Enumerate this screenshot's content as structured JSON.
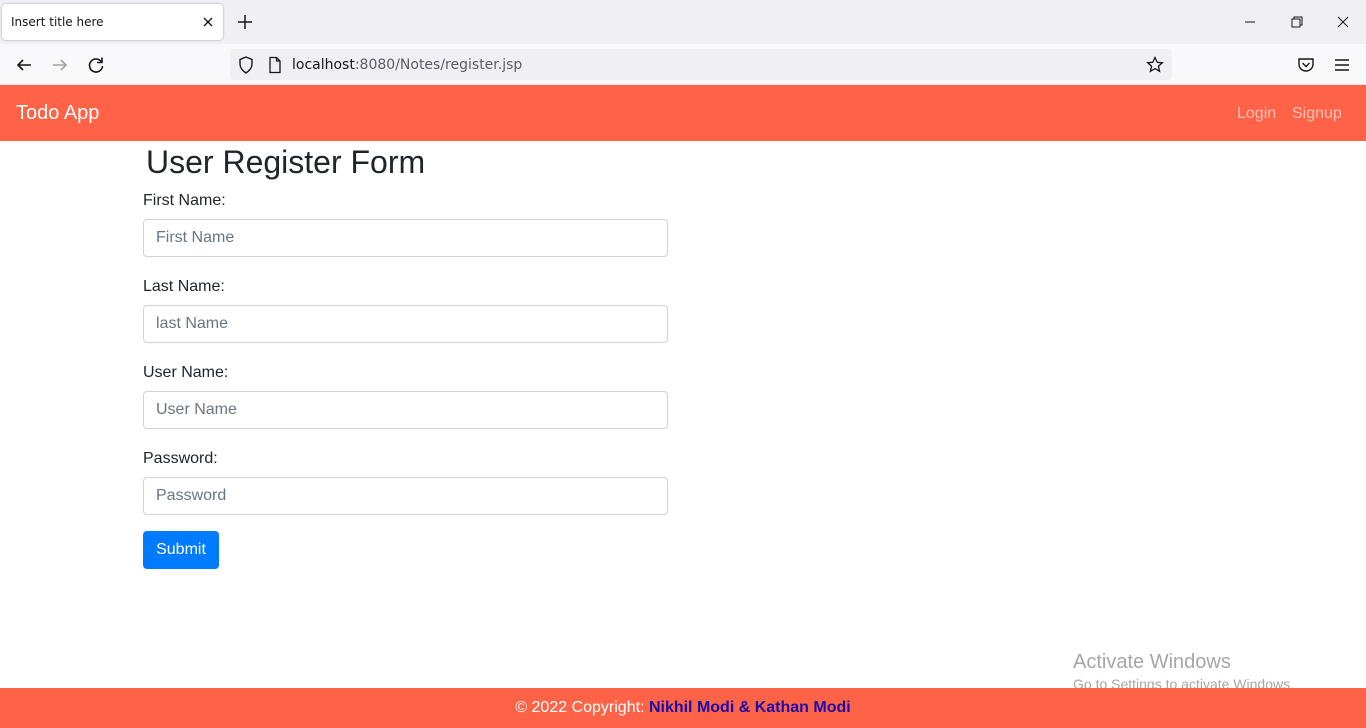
{
  "browser": {
    "tab_title": "Insert title here",
    "url_host": "localhost",
    "url_rest": ":8080/Notes/register.jsp"
  },
  "navbar": {
    "brand": "Todo App",
    "links": [
      "Login",
      "Signup"
    ]
  },
  "form": {
    "title": "User Register Form",
    "fields": [
      {
        "label": "First Name:",
        "placeholder": "First Name"
      },
      {
        "label": "Last Name:",
        "placeholder": "last Name"
      },
      {
        "label": "User Name:",
        "placeholder": "User Name"
      },
      {
        "label": "Password:",
        "placeholder": "Password"
      }
    ],
    "submit_label": "Submit"
  },
  "watermark": {
    "title": "Activate Windows",
    "subtitle": "Go to Settings to activate Windows."
  },
  "footer": {
    "copyright": "© 2022 Copyright: ",
    "authors": "Nikhil Modi & Kathan Modi"
  },
  "colors": {
    "navbar": "#ff6347",
    "submit": "#007bff",
    "footer_authors": "#1a0dab"
  }
}
